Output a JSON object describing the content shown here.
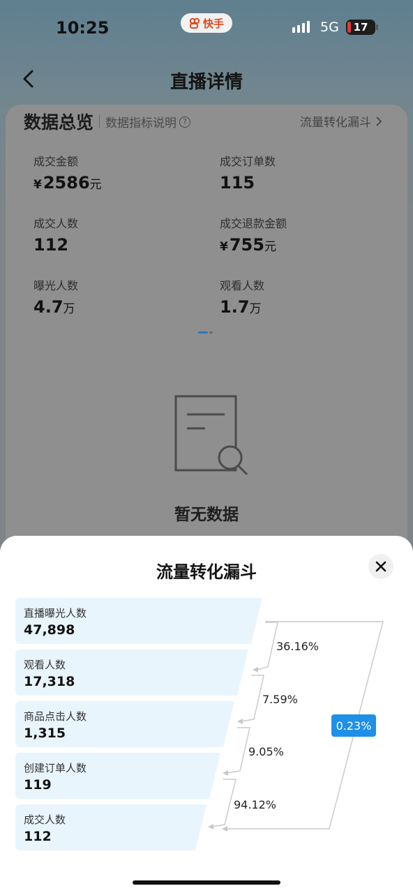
{
  "status_bar": {
    "time": "10:25",
    "app_name": "快手",
    "network": "5G",
    "battery": "17"
  },
  "header": {
    "title": "直播详情"
  },
  "overview": {
    "title": "数据总览",
    "help_label": "数据指标说明",
    "funnel_link": "流量转化漏斗",
    "metrics": [
      {
        "label": "成交金额",
        "prefix": "¥",
        "value": "2586",
        "unit": "元"
      },
      {
        "label": "成交订单数",
        "prefix": "",
        "value": "115",
        "unit": ""
      },
      {
        "label": "成交人数",
        "prefix": "",
        "value": "112",
        "unit": ""
      },
      {
        "label": "成交退款金额",
        "prefix": "¥",
        "value": "755",
        "unit": "元"
      },
      {
        "label": "曝光人数",
        "prefix": "",
        "value": "4.7",
        "unit": "万"
      },
      {
        "label": "观看人数",
        "prefix": "",
        "value": "1.7",
        "unit": "万"
      }
    ],
    "empty_text": "暂无数据"
  },
  "funnel_sheet": {
    "title": "流量转化漏斗",
    "stages": [
      {
        "label": "直播曝光人数",
        "value": "47,898"
      },
      {
        "label": "观看人数",
        "value": "17,318"
      },
      {
        "label": "商品点击人数",
        "value": "1,315"
      },
      {
        "label": "创建订单人数",
        "value": "119"
      },
      {
        "label": "成交人数",
        "value": "112"
      }
    ],
    "step_rates": [
      "36.16%",
      "7.59%",
      "9.05%",
      "94.12%"
    ],
    "overall_rate": "0.23%"
  },
  "colors": {
    "accent": "#1e90e8",
    "stage_fill": "#e9f5fd",
    "brand": "#e04a1f"
  }
}
